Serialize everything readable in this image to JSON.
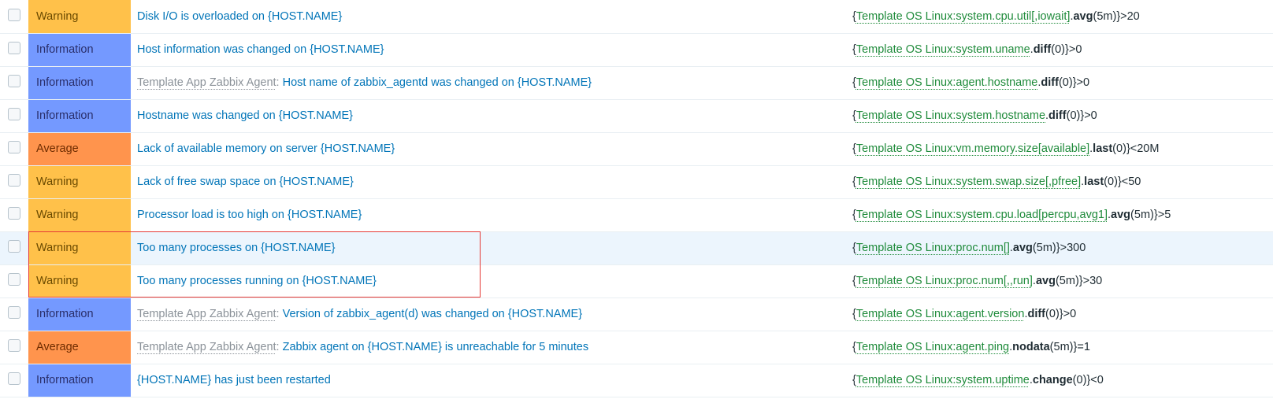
{
  "severity": {
    "Warning": "Warning",
    "Information": "Information",
    "Average": "Average"
  },
  "templates": {
    "zabbix_agent": "Template App Zabbix Agent"
  },
  "rows": [
    {
      "sev": "Warning",
      "sevClass": "s-warning",
      "template": null,
      "name": "Disk I/O is overloaded on {HOST.NAME}",
      "expr_item": "Template OS Linux:system.cpu.util[,iowait]",
      "expr_fn": "avg",
      "expr_arg": "5m",
      "expr_tail": "}>20",
      "highlight": false
    },
    {
      "sev": "Information",
      "sevClass": "s-information",
      "template": null,
      "name": "Host information was changed on {HOST.NAME}",
      "expr_item": "Template OS Linux:system.uname",
      "expr_fn": "diff",
      "expr_arg": "0",
      "expr_tail": "}>0",
      "highlight": false
    },
    {
      "sev": "Information",
      "sevClass": "s-information",
      "template": "zabbix_agent",
      "name": "Host name of zabbix_agentd was changed on {HOST.NAME}",
      "expr_item": "Template OS Linux:agent.hostname",
      "expr_fn": "diff",
      "expr_arg": "0",
      "expr_tail": "}>0",
      "highlight": false
    },
    {
      "sev": "Information",
      "sevClass": "s-information",
      "template": null,
      "name": "Hostname was changed on {HOST.NAME}",
      "expr_item": "Template OS Linux:system.hostname",
      "expr_fn": "diff",
      "expr_arg": "0",
      "expr_tail": "}>0",
      "highlight": false
    },
    {
      "sev": "Average",
      "sevClass": "s-average",
      "template": null,
      "name": "Lack of available memory on server {HOST.NAME}",
      "expr_item": "Template OS Linux:vm.memory.size[available]",
      "expr_fn": "last",
      "expr_arg": "0",
      "expr_tail": "}<20M",
      "highlight": false
    },
    {
      "sev": "Warning",
      "sevClass": "s-warning",
      "template": null,
      "name": "Lack of free swap space on {HOST.NAME}",
      "expr_item": "Template OS Linux:system.swap.size[,pfree]",
      "expr_fn": "last",
      "expr_arg": "0",
      "expr_tail": "}<50",
      "highlight": false
    },
    {
      "sev": "Warning",
      "sevClass": "s-warning",
      "template": null,
      "name": "Processor load is too high on {HOST.NAME}",
      "expr_item": "Template OS Linux:system.cpu.load[percpu,avg1]",
      "expr_fn": "avg",
      "expr_arg": "5m",
      "expr_tail": "}>5",
      "highlight": false
    },
    {
      "sev": "Warning",
      "sevClass": "s-warning",
      "template": null,
      "name": "Too many processes on {HOST.NAME}",
      "expr_item": "Template OS Linux:proc.num[]",
      "expr_fn": "avg",
      "expr_arg": "5m",
      "expr_tail": "}>300",
      "highlight": true
    },
    {
      "sev": "Warning",
      "sevClass": "s-warning",
      "template": null,
      "name": "Too many processes running on {HOST.NAME}",
      "expr_item": "Template OS Linux:proc.num[,,run]",
      "expr_fn": "avg",
      "expr_arg": "5m",
      "expr_tail": "}>30",
      "highlight": false
    },
    {
      "sev": "Information",
      "sevClass": "s-information",
      "template": "zabbix_agent",
      "name": "Version of zabbix_agent(d) was changed on {HOST.NAME}",
      "expr_item": "Template OS Linux:agent.version",
      "expr_fn": "diff",
      "expr_arg": "0",
      "expr_tail": "}>0",
      "highlight": false
    },
    {
      "sev": "Average",
      "sevClass": "s-average",
      "template": "zabbix_agent",
      "name": "Zabbix agent on {HOST.NAME} is unreachable for 5 minutes",
      "expr_item": "Template OS Linux:agent.ping",
      "expr_fn": "nodata",
      "expr_arg": "5m",
      "expr_tail": "}=1",
      "highlight": false
    },
    {
      "sev": "Information",
      "sevClass": "s-information",
      "template": null,
      "name": "{HOST.NAME} has just been restarted",
      "expr_item": "Template OS Linux:system.uptime",
      "expr_fn": "change",
      "expr_arg": "0",
      "expr_tail": "}<0",
      "highlight": false
    }
  ]
}
